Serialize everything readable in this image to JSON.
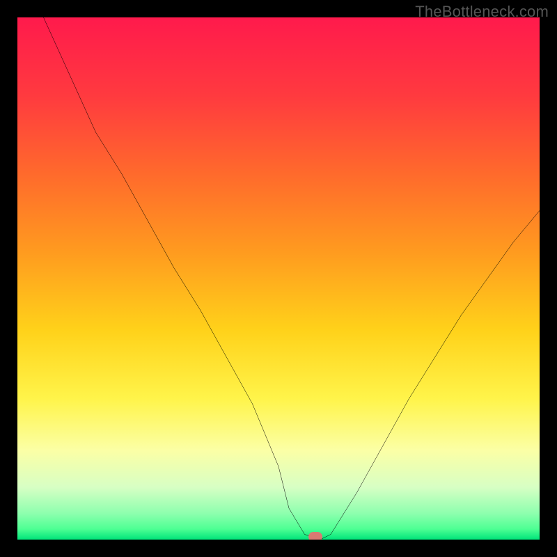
{
  "watermark": "TheBottleneck.com",
  "chart_data": {
    "type": "line",
    "title": "",
    "xlabel": "",
    "ylabel": "",
    "xlim": [
      0,
      100
    ],
    "ylim": [
      0,
      100
    ],
    "grid": false,
    "legend": false,
    "series": [
      {
        "name": "bottleneck-curve",
        "x": [
          5,
          10,
          15,
          20,
          25,
          30,
          35,
          40,
          45,
          50,
          52,
          55,
          58,
          60,
          65,
          70,
          75,
          80,
          85,
          90,
          95,
          100
        ],
        "y": [
          100,
          89,
          78,
          70,
          61,
          52,
          44,
          35,
          26,
          14,
          6,
          1,
          0,
          1,
          9,
          18,
          27,
          35,
          43,
          50,
          57,
          63
        ]
      }
    ],
    "marker": {
      "x": 57,
      "y": 0.5,
      "color": "#d87a72"
    },
    "background_gradient": {
      "stops": [
        {
          "pos": 0.0,
          "color": "#ff1a4c"
        },
        {
          "pos": 0.15,
          "color": "#ff3a3f"
        },
        {
          "pos": 0.3,
          "color": "#ff6a2c"
        },
        {
          "pos": 0.45,
          "color": "#ff9b1f"
        },
        {
          "pos": 0.6,
          "color": "#ffd21a"
        },
        {
          "pos": 0.73,
          "color": "#fff44a"
        },
        {
          "pos": 0.83,
          "color": "#fbffa6"
        },
        {
          "pos": 0.9,
          "color": "#d7ffc4"
        },
        {
          "pos": 0.95,
          "color": "#8dffae"
        },
        {
          "pos": 0.98,
          "color": "#4dff93"
        },
        {
          "pos": 1.0,
          "color": "#00e47a"
        }
      ]
    }
  }
}
